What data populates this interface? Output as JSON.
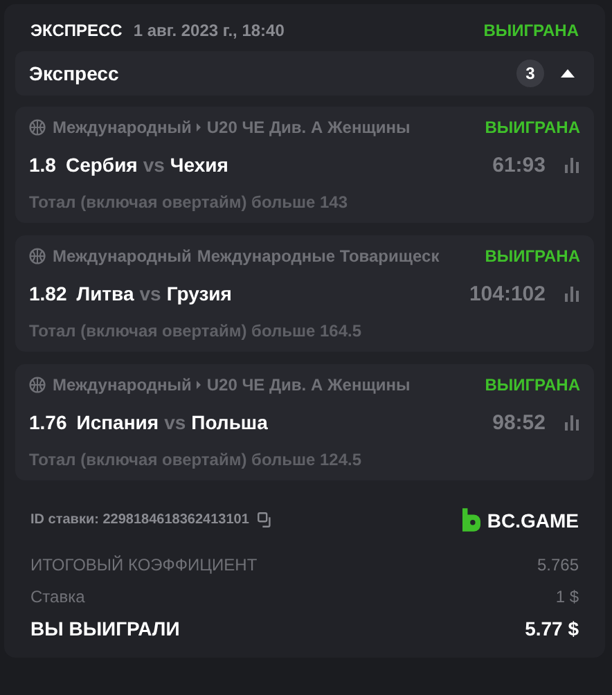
{
  "header": {
    "title": "ЭКСПРЕСС",
    "date": "1 авг. 2023 г., 18:40",
    "status": "ВЫИГРАНА"
  },
  "express": {
    "label": "Экспресс",
    "count": "3",
    "expanded": true
  },
  "legs": [
    {
      "region": "Международный",
      "arrow": true,
      "league": "U20 ЧЕ Див. А Женщины",
      "status": "ВЫИГРАНА",
      "odds": "1.8",
      "home": "Сербия",
      "vs": "vs",
      "away": "Чехия",
      "score": "61:93",
      "market": "Тотал (включая овертайм) больше 143"
    },
    {
      "region": "Международный",
      "arrow": false,
      "league": "Международные Товарищеск",
      "status": "ВЫИГРАНА",
      "odds": "1.82",
      "home": "Литва",
      "vs": "vs",
      "away": "Грузия",
      "score": "104:102",
      "market": "Тотал (включая овертайм) больше 164.5"
    },
    {
      "region": "Международный",
      "arrow": true,
      "league": "U20 ЧЕ Див. А Женщины",
      "status": "ВЫИГРАНА",
      "odds": "1.76",
      "home": "Испания",
      "vs": "vs",
      "away": "Польша",
      "score": "98:52",
      "market": "Тотал (включая овертайм) больше 124.5"
    }
  ],
  "bet_id": "ID ставки: 2298184618362413101",
  "brand": "BC.GAME",
  "summary": [
    {
      "kind": "muted",
      "label": "ИТОГОВЫЙ КОЭФФИЦИЕНТ",
      "value": "5.765"
    },
    {
      "kind": "muted",
      "label": "Ставка",
      "value": "1 $"
    },
    {
      "kind": "total",
      "label": "ВЫ ВЫИГРАЛИ",
      "value": "5.77 $"
    }
  ]
}
